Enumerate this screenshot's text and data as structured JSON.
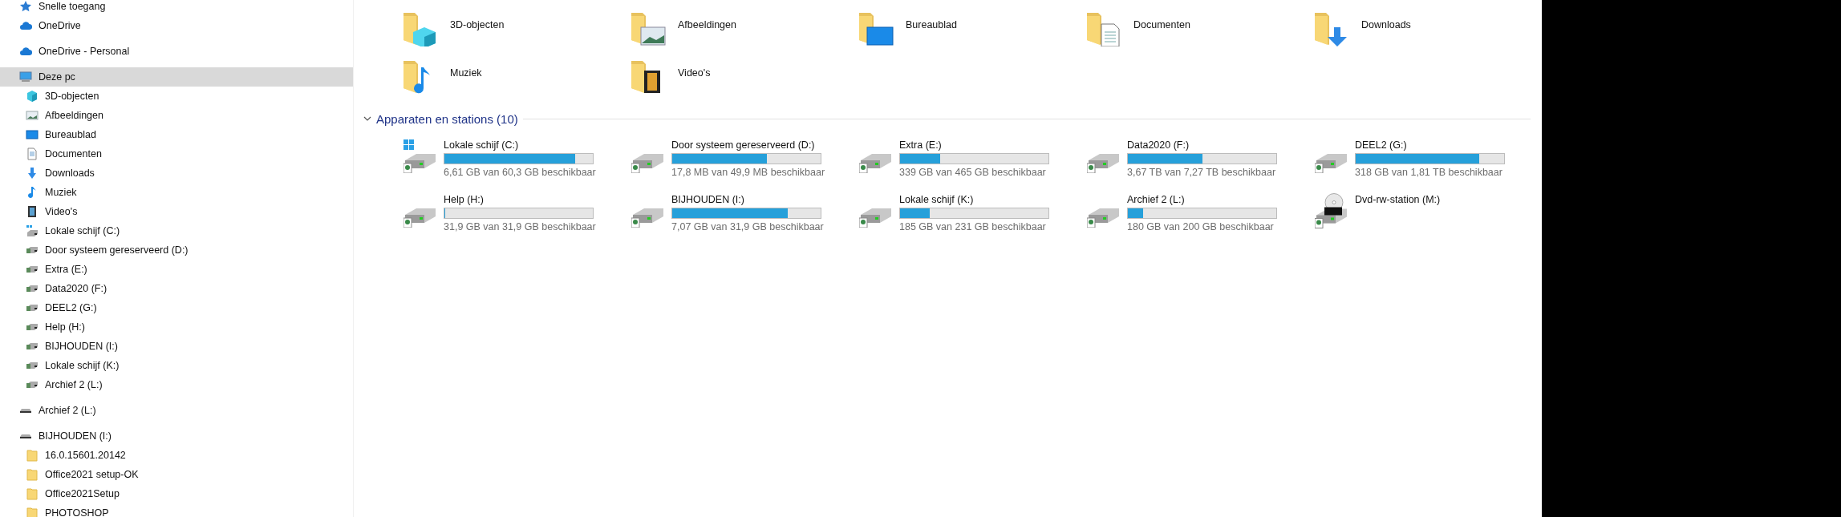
{
  "sidebar": {
    "items": [
      {
        "label": "Snelle toegang",
        "kind": "star",
        "selected": false
      },
      {
        "label": "OneDrive",
        "kind": "cloud",
        "selected": false
      },
      {
        "label": "OneDrive - Personal",
        "kind": "cloud",
        "selected": false
      },
      {
        "label": "Deze pc",
        "kind": "pc",
        "selected": true,
        "children": [
          {
            "label": "3D-objecten",
            "kind": "cube",
            "selected": false
          },
          {
            "label": "Afbeeldingen",
            "kind": "pictures",
            "selected": false
          },
          {
            "label": "Bureaublad",
            "kind": "desktop",
            "selected": false
          },
          {
            "label": "Documenten",
            "kind": "documents",
            "selected": false
          },
          {
            "label": "Downloads",
            "kind": "downloads",
            "selected": false
          },
          {
            "label": "Muziek",
            "kind": "music",
            "selected": false
          },
          {
            "label": "Video's",
            "kind": "videos",
            "selected": false
          },
          {
            "label": "Lokale schijf (C:)",
            "kind": "drive-windows",
            "selected": false
          },
          {
            "label": "Door systeem gereserveerd (D:)",
            "kind": "drive",
            "selected": false
          },
          {
            "label": "Extra (E:)",
            "kind": "drive",
            "selected": false
          },
          {
            "label": "Data2020 (F:)",
            "kind": "drive",
            "selected": false
          },
          {
            "label": "DEEL2 (G:)",
            "kind": "drive",
            "selected": false
          },
          {
            "label": "Help (H:)",
            "kind": "drive",
            "selected": false
          },
          {
            "label": "BIJHOUDEN (I:)",
            "kind": "drive",
            "selected": false
          },
          {
            "label": "Lokale schijf (K:)",
            "kind": "drive",
            "selected": false
          },
          {
            "label": "Archief 2 (L:)",
            "kind": "drive",
            "selected": false
          }
        ]
      },
      {
        "label": "Archief 2 (L:)",
        "kind": "drive-plain",
        "selected": false
      },
      {
        "label": "BIJHOUDEN (I:)",
        "kind": "drive-plain",
        "selected": false,
        "children": [
          {
            "label": "16.0.15601.20142",
            "kind": "folder",
            "selected": false
          },
          {
            "label": "Office2021 setup-OK",
            "kind": "folder",
            "selected": false
          },
          {
            "label": "Office2021Setup",
            "kind": "folder",
            "selected": false
          },
          {
            "label": "PHOTOSHOP",
            "kind": "folder",
            "selected": false
          }
        ]
      }
    ]
  },
  "folders": {
    "items": [
      {
        "label": "3D-objecten",
        "kind": "cube"
      },
      {
        "label": "Afbeeldingen",
        "kind": "pictures"
      },
      {
        "label": "Bureaublad",
        "kind": "desktop"
      },
      {
        "label": "Documenten",
        "kind": "documents"
      },
      {
        "label": "Downloads",
        "kind": "downloads"
      },
      {
        "label": "Muziek",
        "kind": "music"
      },
      {
        "label": "Video's",
        "kind": "videos"
      }
    ]
  },
  "devices": {
    "title": "Apparaten en stations (10)",
    "expanded": true,
    "items": [
      {
        "name": "Lokale schijf (C:)",
        "kind": "windows",
        "level": 0.88,
        "reading": "6,61 GB van 60,3 GB beschikbaar"
      },
      {
        "name": "Door systeem gereserveerd (D:)",
        "kind": "hdd",
        "level": 0.64,
        "reading": "17,8 MB van 49,9 MB beschikbaar"
      },
      {
        "name": "Extra (E:)",
        "kind": "hdd",
        "level": 0.27,
        "reading": "339 GB van 465 GB beschikbaar"
      },
      {
        "name": "Data2020 (F:)",
        "kind": "hdd",
        "level": 0.5,
        "reading": "3,67 TB van 7,27 TB beschikbaar"
      },
      {
        "name": "DEEL2 (G:)",
        "kind": "hdd",
        "level": 0.83,
        "reading": "318 GB van 1,81 TB beschikbaar"
      },
      {
        "name": "Help (H:)",
        "kind": "hdd",
        "level": 0,
        "reading": "31,9 GB van 31,9 GB beschikbaar"
      },
      {
        "name": "BIJHOUDEN (I:)",
        "kind": "hdd",
        "level": 0.78,
        "reading": "7,07 GB van 31,9 GB beschikbaar"
      },
      {
        "name": "Lokale schijf (K:)",
        "kind": "hdd",
        "level": 0.2,
        "reading": "185 GB van 231 GB beschikbaar"
      },
      {
        "name": "Archief 2 (L:)",
        "kind": "hdd",
        "level": 0.1,
        "reading": "180 GB van 200 GB beschikbaar"
      },
      {
        "name": "Dvd-rw-station (M:)",
        "kind": "dvd"
      }
    ]
  }
}
